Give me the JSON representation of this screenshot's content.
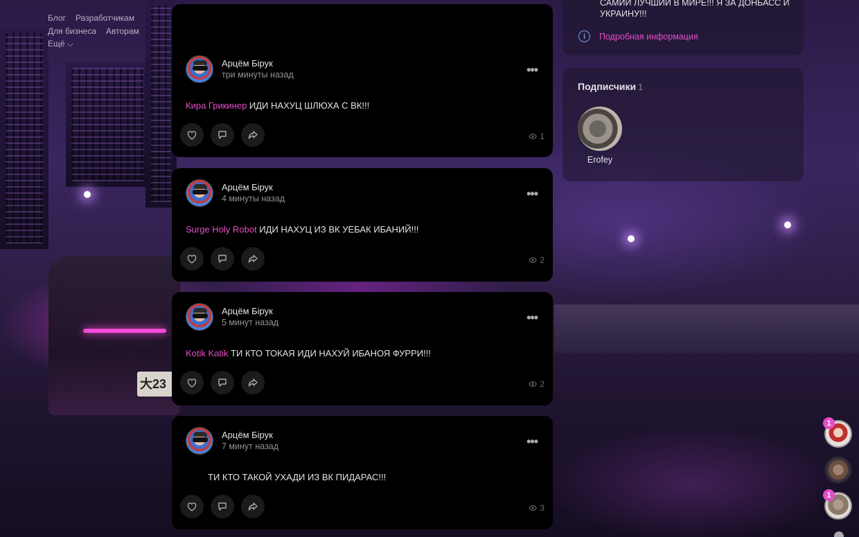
{
  "colors": {
    "accent": "#e64ec8",
    "card": "#000000",
    "text": "#e1e3e6",
    "muted": "#939393"
  },
  "left_nav": {
    "items": [
      [
        {
          "label": "Блог"
        },
        {
          "label": "Разработчикам"
        }
      ],
      [
        {
          "label": "Для бизнеса"
        },
        {
          "label": "Авторам"
        }
      ],
      [
        {
          "label": "Ещё ⌵"
        }
      ]
    ]
  },
  "background": {
    "plate_text": "大23"
  },
  "posts": [
    {
      "author": "Арцём Бірук",
      "time": "три минуты назад",
      "mention": "Кира Грикинер",
      "text": " ИДИ НАХУЦ ШЛЮХА С ВК!!!",
      "views": "1"
    },
    {
      "author": "Арцём Бірук",
      "time": "4 минуты назад",
      "mention": "Surge Holy Robot",
      "text": " ИДИ НАХУЦ ИЗ ВК УЕБАК ИБАНИЙ!!!",
      "views": "2"
    },
    {
      "author": "Арцём Бірук",
      "time": "5 минут назад",
      "mention": "Kotik Katik",
      "text": " ТИ КТО ТОКАЯ ИДИ НАХУЙ ИБАНОЯ ФУРРИ!!!",
      "views": "2"
    },
    {
      "author": "Арцём Бірук",
      "time": "7 минут назад",
      "mention": "",
      "text": "ТИ КТО ТАКОЙ УХАДИ ИЗ ВК ПИДАРАС!!!",
      "views": "3"
    }
  ],
  "post_more": "•••",
  "profile": {
    "status": "САМИЙ ЛУЧШИЙ В МИРЕ!!! Я ЗА ДОНБАСС И УКРАИНУ!!!",
    "info_link": "Подробная информация",
    "info_icon": "i"
  },
  "subscribers": {
    "title": "Подписчики",
    "count": "1",
    "items": [
      {
        "name": "Erofey"
      }
    ]
  },
  "chats": [
    {
      "badge": "1"
    },
    {
      "badge": ""
    },
    {
      "badge": "1"
    }
  ]
}
